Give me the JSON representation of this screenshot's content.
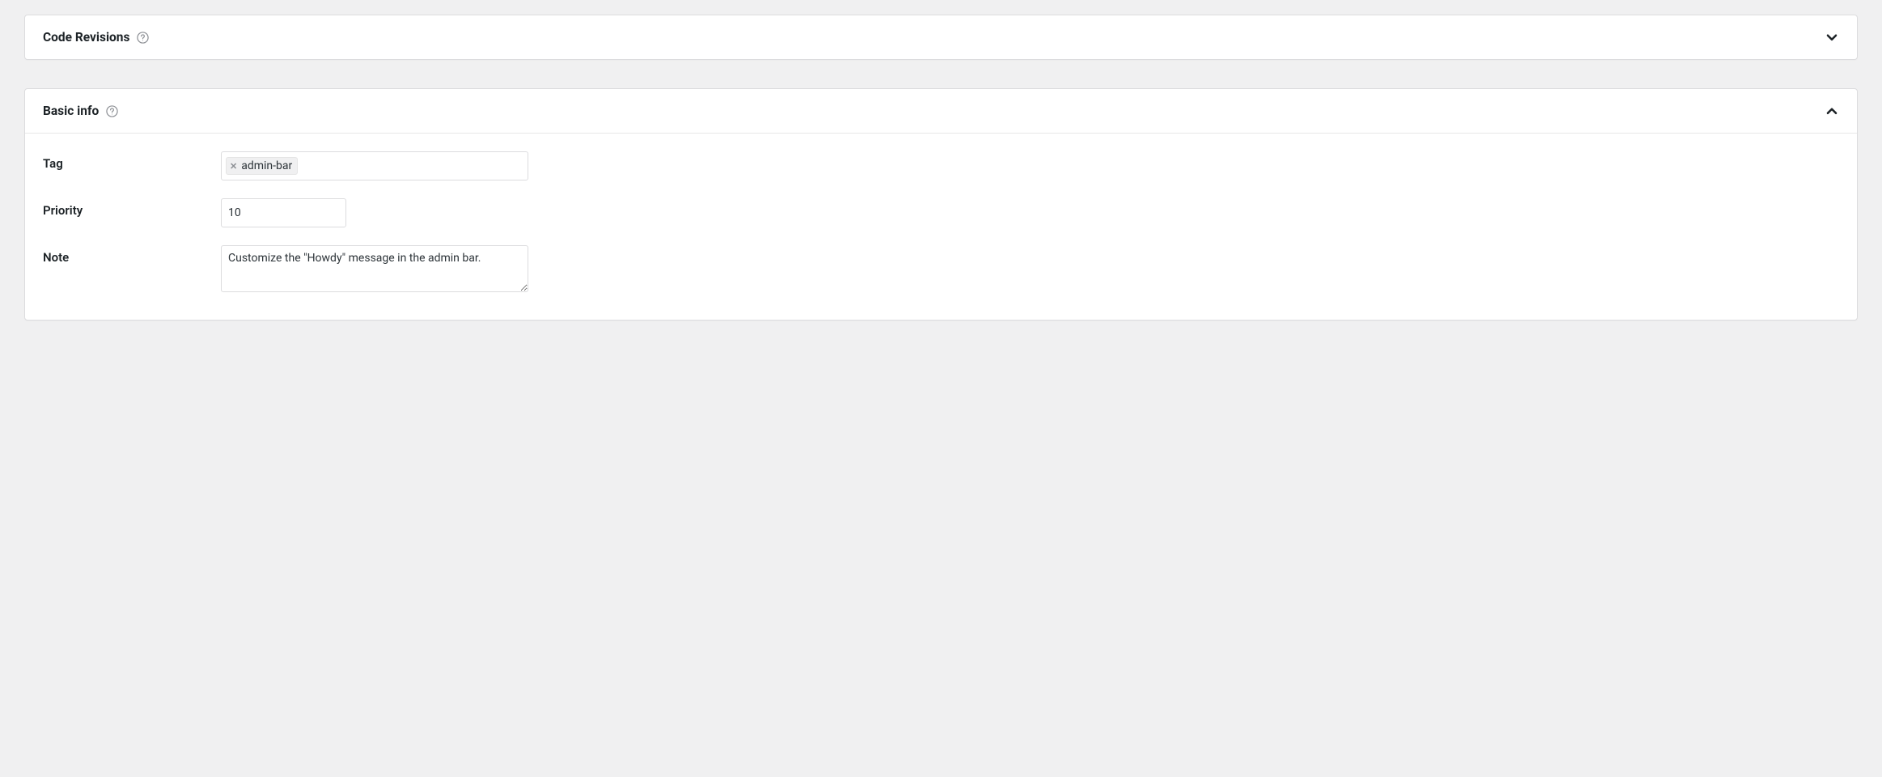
{
  "panels": {
    "code_revisions": {
      "title": "Code Revisions",
      "expanded": false
    },
    "basic_info": {
      "title": "Basic info",
      "expanded": true,
      "fields": {
        "tag": {
          "label": "Tag",
          "chips": [
            "admin-bar"
          ]
        },
        "priority": {
          "label": "Priority",
          "value": "10"
        },
        "note": {
          "label": "Note",
          "value": "Customize the \"Howdy\" message in the admin bar."
        }
      }
    }
  }
}
